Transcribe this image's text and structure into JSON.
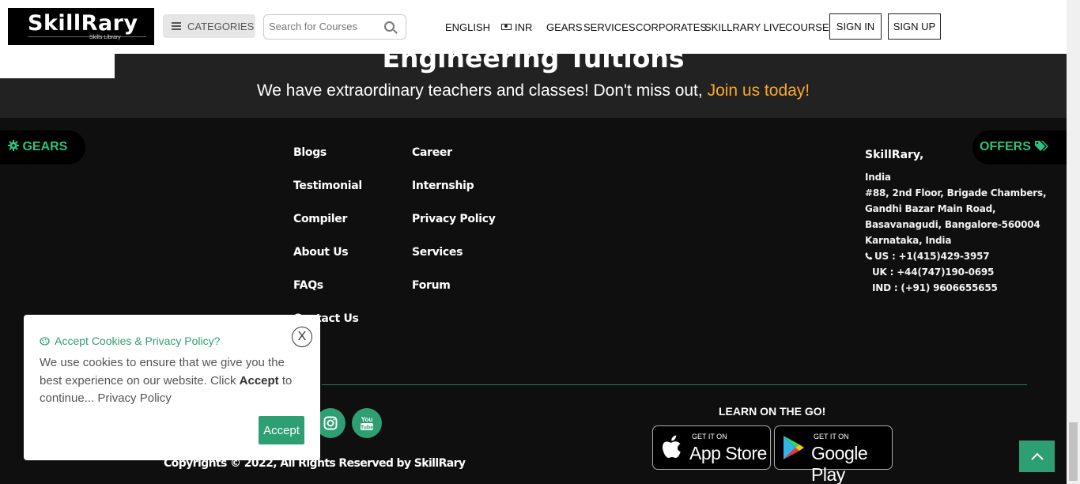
{
  "header": {
    "logo_text": "SkillRary",
    "logo_tagline": "Skills Library",
    "categories_label": "CATEGORIES",
    "search_placeholder": "Search for Courses",
    "nav": {
      "english": "ENGLISH",
      "currency": "INR",
      "gears": "GEARS",
      "services": "SERVICES",
      "corporates": "CORPORATES",
      "skillrary_live": "SKILLRARY LIVE",
      "course": "COURSE",
      "sign_in": "SIGN IN",
      "sign_up": "SIGN UP"
    }
  },
  "hero": {
    "title": "Engineering Tuitions",
    "tagline": "We have extraordinary teachers and classes! Don't miss out, ",
    "cta": "Join us today!"
  },
  "side": {
    "gears_label": "GEARS",
    "offers_label": "OFFERS"
  },
  "footer": {
    "col1": [
      "Blogs",
      "Testimonial",
      "Compiler",
      "About Us",
      "FAQs",
      "Contact Us"
    ],
    "col2": [
      "Career",
      "Internship",
      "Privacy Policy",
      "Services",
      "Forum"
    ],
    "address": {
      "title": "SkillRary,",
      "lines": [
        "India",
        "#88, 2nd Floor, Brigade Chambers,",
        "Gandhi Bazar Main Road,",
        "Basavanagudi, Bangalore-560004",
        "Karnataka, India",
        "US : +1(415)429-3957",
        "UK : +44(747)190-0695",
        "IND : (+91) 9606655655"
      ]
    },
    "learn_on_the_go": "LEARN ON THE GO!",
    "app_store": {
      "small": "GET IT ON",
      "big": "App Store"
    },
    "google_play": {
      "small": "GET IT ON",
      "big": "Google Play"
    },
    "youtube_text": "You Tube",
    "copyright": "Copyrights © 2022, All Rights Reserved by SkillRary"
  },
  "cookie": {
    "title": "Accept Cookies & Privacy Policy?",
    "close_label": "X",
    "text_before": "We use cookies to ensure that we give you the best experience on our website. Click ",
    "text_bold": "Accept",
    "text_after": " to continue... Privacy Policy",
    "accept_label": "Accept"
  },
  "colors": {
    "accent": "#2e9e73",
    "cta": "#f7a928",
    "footer_bg": "#0f0f0f",
    "hero_bg": "#222222"
  }
}
